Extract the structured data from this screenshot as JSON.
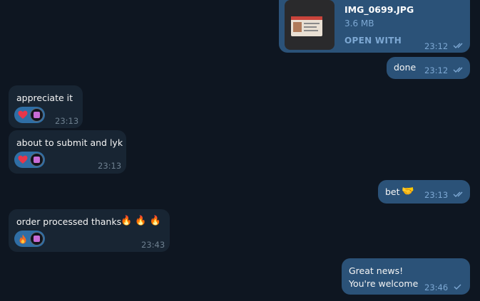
{
  "messages": {
    "file": {
      "name": "IMG_0699.JPG",
      "size": "3.6 MB",
      "action": "OPEN WITH",
      "time": "23:12"
    },
    "done": {
      "text": "done",
      "time": "23:12"
    },
    "appreciate": {
      "text": "appreciate it",
      "time": "23:13",
      "reactions": [
        "heart",
        "avatar"
      ]
    },
    "submit": {
      "text": "about to submit and lyk",
      "time": "23:13",
      "reactions": [
        "heart",
        "avatar"
      ]
    },
    "bet": {
      "text": "bet",
      "emoji": "🤝",
      "time": "23:13"
    },
    "order": {
      "text": "order processed thanks",
      "emoji": "🔥 🔥 🔥",
      "time": "23:43",
      "reactions": [
        "fire",
        "avatar"
      ]
    },
    "great": {
      "line1": "Great news!",
      "line2": "You're welcome",
      "time": "23:46"
    }
  },
  "colors": {
    "background": "#0e1621",
    "outgoing_bubble": "#2b5278",
    "incoming_bubble": "#182533",
    "reaction_pill": "#2f6ea5",
    "heart": "#e8364a"
  },
  "icons": [
    "double-check-icon",
    "single-check-icon",
    "heart-icon",
    "fire-icon",
    "handshake-icon",
    "avatar"
  ]
}
